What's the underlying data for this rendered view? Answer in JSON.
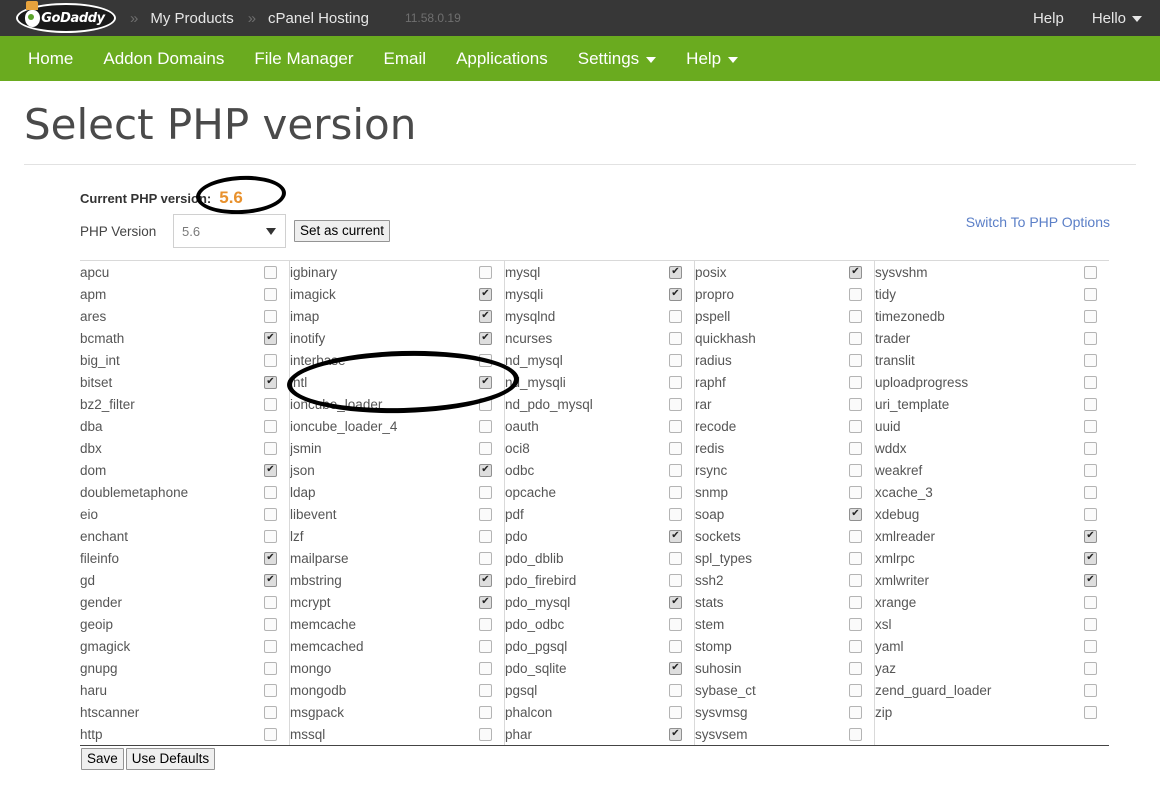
{
  "topbar": {
    "logo_text": "GoDaddy",
    "breadcrumbs": [
      {
        "label": "My Products"
      },
      {
        "label": "cPanel Hosting"
      }
    ],
    "separator": "»",
    "version_tag": "11.58.0.19",
    "help_label": "Help",
    "account_label": "Hello"
  },
  "nav": {
    "items": [
      {
        "label": "Home",
        "has_caret": false
      },
      {
        "label": "Addon Domains",
        "has_caret": false
      },
      {
        "label": "File Manager",
        "has_caret": false
      },
      {
        "label": "Email",
        "has_caret": false
      },
      {
        "label": "Applications",
        "has_caret": false
      },
      {
        "label": "Settings",
        "has_caret": true
      },
      {
        "label": "Help",
        "has_caret": true
      }
    ]
  },
  "page": {
    "title": "Select PHP version",
    "current_version_label": "Current PHP version:",
    "current_version_value": "5.6",
    "php_version_label": "PHP Version",
    "php_version_selected": "5.6",
    "set_as_current_label": "Set as current",
    "switch_link_label": "Switch To PHP Options",
    "save_label": "Save",
    "use_defaults_label": "Use Defaults"
  },
  "colors": {
    "topbar_bg": "#373737",
    "nav_bg": "#6aab1f",
    "accent_orange": "#e8912d",
    "link_blue": "#5b7fc7",
    "annotation": "#000000"
  },
  "extensions": {
    "columns": [
      {
        "items": [
          {
            "name": "apcu",
            "checked": false
          },
          {
            "name": "apm",
            "checked": false
          },
          {
            "name": "ares",
            "checked": false
          },
          {
            "name": "bcmath",
            "checked": true
          },
          {
            "name": "big_int",
            "checked": false
          },
          {
            "name": "bitset",
            "checked": true
          },
          {
            "name": "bz2_filter",
            "checked": false
          },
          {
            "name": "dba",
            "checked": false
          },
          {
            "name": "dbx",
            "checked": false
          },
          {
            "name": "dom",
            "checked": true
          },
          {
            "name": "doublemetaphone",
            "checked": false
          },
          {
            "name": "eio",
            "checked": false
          },
          {
            "name": "enchant",
            "checked": false
          },
          {
            "name": "fileinfo",
            "checked": true
          },
          {
            "name": "gd",
            "checked": true
          },
          {
            "name": "gender",
            "checked": false
          },
          {
            "name": "geoip",
            "checked": false
          },
          {
            "name": "gmagick",
            "checked": false
          },
          {
            "name": "gnupg",
            "checked": false
          },
          {
            "name": "haru",
            "checked": false
          },
          {
            "name": "htscanner",
            "checked": false
          },
          {
            "name": "http",
            "checked": false
          }
        ]
      },
      {
        "items": [
          {
            "name": "igbinary",
            "checked": false
          },
          {
            "name": "imagick",
            "checked": true
          },
          {
            "name": "imap",
            "checked": true
          },
          {
            "name": "inotify",
            "checked": true
          },
          {
            "name": "interbase",
            "checked": false
          },
          {
            "name": "intl",
            "checked": true
          },
          {
            "name": "ioncube_loader",
            "checked": false
          },
          {
            "name": "ioncube_loader_4",
            "checked": false
          },
          {
            "name": "jsmin",
            "checked": false
          },
          {
            "name": "json",
            "checked": true
          },
          {
            "name": "ldap",
            "checked": false
          },
          {
            "name": "libevent",
            "checked": false
          },
          {
            "name": "lzf",
            "checked": false
          },
          {
            "name": "mailparse",
            "checked": false
          },
          {
            "name": "mbstring",
            "checked": true
          },
          {
            "name": "mcrypt",
            "checked": true
          },
          {
            "name": "memcache",
            "checked": false
          },
          {
            "name": "memcached",
            "checked": false
          },
          {
            "name": "mongo",
            "checked": false
          },
          {
            "name": "mongodb",
            "checked": false
          },
          {
            "name": "msgpack",
            "checked": false
          },
          {
            "name": "mssql",
            "checked": false
          }
        ]
      },
      {
        "items": [
          {
            "name": "mysql",
            "checked": true
          },
          {
            "name": "mysqli",
            "checked": true
          },
          {
            "name": "mysqlnd",
            "checked": false
          },
          {
            "name": "ncurses",
            "checked": false
          },
          {
            "name": "nd_mysql",
            "checked": false
          },
          {
            "name": "nd_mysqli",
            "checked": false
          },
          {
            "name": "nd_pdo_mysql",
            "checked": false
          },
          {
            "name": "oauth",
            "checked": false
          },
          {
            "name": "oci8",
            "checked": false
          },
          {
            "name": "odbc",
            "checked": false
          },
          {
            "name": "opcache",
            "checked": false
          },
          {
            "name": "pdf",
            "checked": false
          },
          {
            "name": "pdo",
            "checked": true
          },
          {
            "name": "pdo_dblib",
            "checked": false
          },
          {
            "name": "pdo_firebird",
            "checked": false
          },
          {
            "name": "pdo_mysql",
            "checked": true
          },
          {
            "name": "pdo_odbc",
            "checked": false
          },
          {
            "name": "pdo_pgsql",
            "checked": false
          },
          {
            "name": "pdo_sqlite",
            "checked": true
          },
          {
            "name": "pgsql",
            "checked": false
          },
          {
            "name": "phalcon",
            "checked": false
          },
          {
            "name": "phar",
            "checked": true
          }
        ]
      },
      {
        "items": [
          {
            "name": "posix",
            "checked": true
          },
          {
            "name": "propro",
            "checked": false
          },
          {
            "name": "pspell",
            "checked": false
          },
          {
            "name": "quickhash",
            "checked": false
          },
          {
            "name": "radius",
            "checked": false
          },
          {
            "name": "raphf",
            "checked": false
          },
          {
            "name": "rar",
            "checked": false
          },
          {
            "name": "recode",
            "checked": false
          },
          {
            "name": "redis",
            "checked": false
          },
          {
            "name": "rsync",
            "checked": false
          },
          {
            "name": "snmp",
            "checked": false
          },
          {
            "name": "soap",
            "checked": true
          },
          {
            "name": "sockets",
            "checked": false
          },
          {
            "name": "spl_types",
            "checked": false
          },
          {
            "name": "ssh2",
            "checked": false
          },
          {
            "name": "stats",
            "checked": false
          },
          {
            "name": "stem",
            "checked": false
          },
          {
            "name": "stomp",
            "checked": false
          },
          {
            "name": "suhosin",
            "checked": false
          },
          {
            "name": "sybase_ct",
            "checked": false
          },
          {
            "name": "sysvmsg",
            "checked": false
          },
          {
            "name": "sysvsem",
            "checked": false
          }
        ]
      },
      {
        "items": [
          {
            "name": "sysvshm",
            "checked": false
          },
          {
            "name": "tidy",
            "checked": false
          },
          {
            "name": "timezonedb",
            "checked": false
          },
          {
            "name": "trader",
            "checked": false
          },
          {
            "name": "translit",
            "checked": false
          },
          {
            "name": "uploadprogress",
            "checked": false
          },
          {
            "name": "uri_template",
            "checked": false
          },
          {
            "name": "uuid",
            "checked": false
          },
          {
            "name": "wddx",
            "checked": false
          },
          {
            "name": "weakref",
            "checked": false
          },
          {
            "name": "xcache_3",
            "checked": false
          },
          {
            "name": "xdebug",
            "checked": false
          },
          {
            "name": "xmlreader",
            "checked": true
          },
          {
            "name": "xmlrpc",
            "checked": true
          },
          {
            "name": "xmlwriter",
            "checked": true
          },
          {
            "name": "xrange",
            "checked": false
          },
          {
            "name": "xsl",
            "checked": false
          },
          {
            "name": "yaml",
            "checked": false
          },
          {
            "name": "yaz",
            "checked": false
          },
          {
            "name": "zend_guard_loader",
            "checked": false
          },
          {
            "name": "zip",
            "checked": false
          }
        ]
      }
    ]
  }
}
